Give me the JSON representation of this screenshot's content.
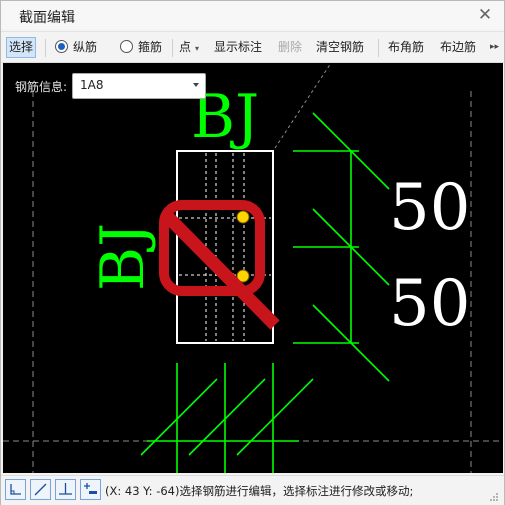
{
  "window": {
    "title": "截面编辑",
    "close_glyph": "✕"
  },
  "toolbar": {
    "select": "选择",
    "radio_longitudinal": "纵筋",
    "radio_stirrup": "箍筋",
    "point_dropdown": "点",
    "show_dimension": "显示标注",
    "delete": "删除",
    "clear_rebar": "清空钢筋",
    "corner_rebar": "布角筋",
    "edge_rebar": "布边筋",
    "more": "▸▸"
  },
  "rebar_info": {
    "label": "钢筋信息:",
    "value": "1A8"
  },
  "canvas": {
    "label_top": "BJ",
    "label_left": "BJ",
    "dim_1": "50",
    "dim_2": "50",
    "colors": {
      "background": "#000000",
      "section": "#ffffff",
      "annotation": "#00ff00",
      "forbidden": "#c8151b",
      "rebar": "#ffd400"
    }
  },
  "statusbar": {
    "text": "(X: 43 Y: -64)选择钢筋进行编辑，选择标注进行修改或移动;",
    "icons": [
      "corner-snap-icon",
      "diagonal-line-icon",
      "perpendicular-icon",
      "add-point-icon"
    ]
  }
}
